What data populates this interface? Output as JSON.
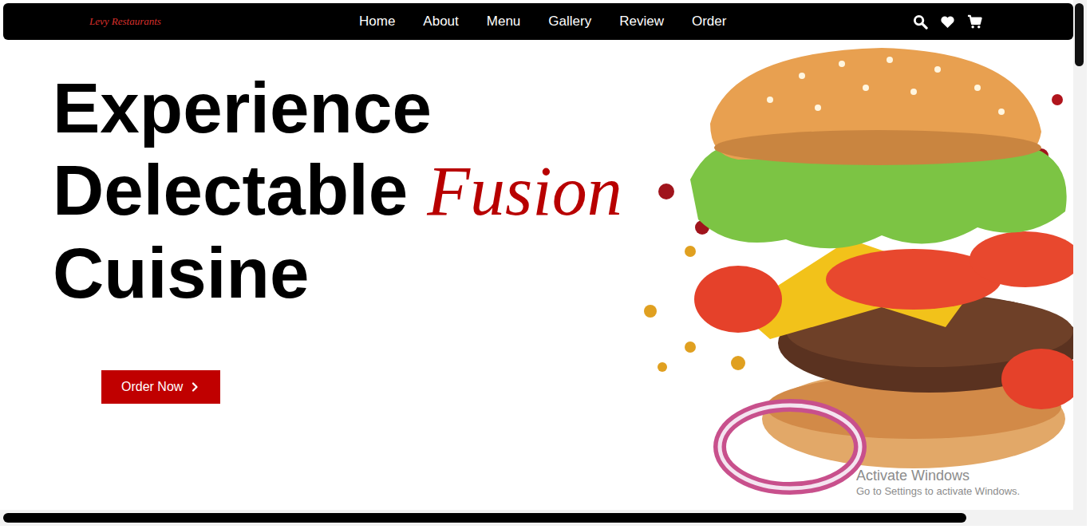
{
  "logo": "Levy Restaurants",
  "nav": {
    "links": [
      "Home",
      "About",
      "Menu",
      "Gallery",
      "Review",
      "Order"
    ]
  },
  "hero": {
    "headline": [
      [
        {
          "text": "Experience",
          "kind": "plain"
        }
      ],
      [
        {
          "text": "Delectable",
          "kind": "plain"
        },
        {
          "text": "Fusion",
          "kind": "accent"
        }
      ],
      [
        {
          "text": "Cuisine",
          "kind": "plain"
        }
      ]
    ],
    "button": "Order Now"
  },
  "watermark": {
    "title": "Activate Windows",
    "subtitle": "Go to Settings to activate Windows."
  },
  "scrollbars": {
    "vertical": {
      "level": 0.12
    },
    "horizontal": {
      "level": 0.9
    }
  }
}
